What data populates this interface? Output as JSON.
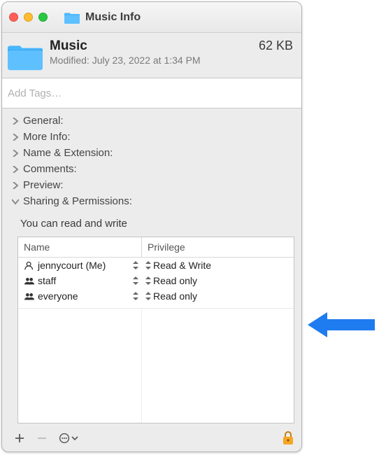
{
  "window": {
    "title": "Music Info"
  },
  "summary": {
    "name": "Music",
    "size": "62 KB",
    "modified_label": "Modified:",
    "modified_value": "July 23, 2022 at 1:34 PM"
  },
  "tags": {
    "placeholder": "Add Tags…"
  },
  "sections": {
    "general": "General:",
    "more_info": "More Info:",
    "name_ext": "Name & Extension:",
    "comments": "Comments:",
    "preview": "Preview:",
    "sharing": "Sharing & Permissions:"
  },
  "permissions": {
    "note": "You can read and write",
    "columns": {
      "name": "Name",
      "privilege": "Privilege"
    },
    "rows": [
      {
        "user": "jennycourt (Me)",
        "icon": "user-icon",
        "privilege": "Read & Write"
      },
      {
        "user": "staff",
        "icon": "group-icon",
        "privilege": "Read only"
      },
      {
        "user": "everyone",
        "icon": "group-icon",
        "privilege": "Read only"
      }
    ]
  },
  "colors": {
    "folder": "#3fb3ff",
    "lock": "#f5a623",
    "arrow": "#1e7bf0"
  }
}
